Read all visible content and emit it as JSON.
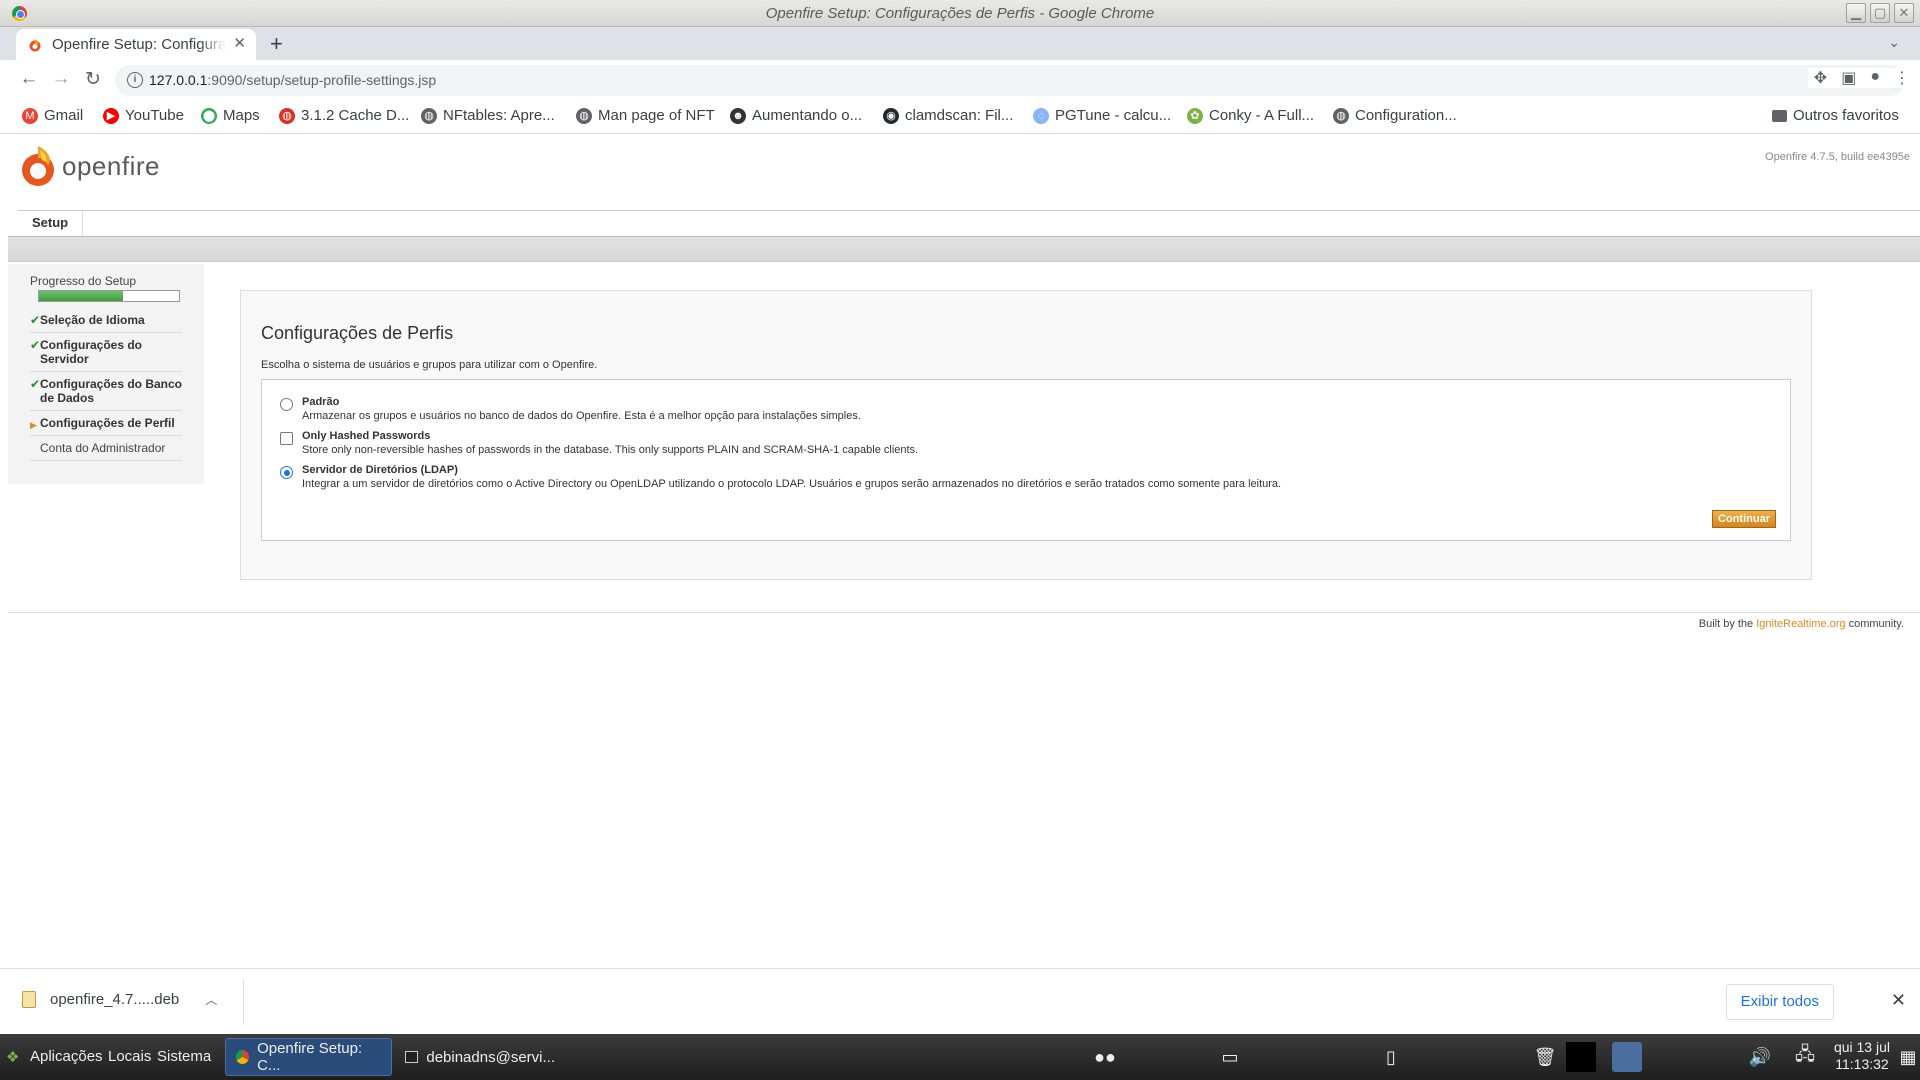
{
  "window": {
    "title": "Openfire Setup: Configurações de Perfis - Google Chrome",
    "buttons": [
      "▁",
      "▢",
      "✕"
    ]
  },
  "tabs": {
    "active_title": "Openfire Setup: Configurações de Perfis",
    "close": "✕",
    "new_tab": "+",
    "menu": "⌄"
  },
  "toolbar": {
    "back": "←",
    "forward": "→",
    "reload": "↻",
    "url_host": "127.0.0.1",
    "url_path": ":9090/setup/setup-profile-settings.jsp"
  },
  "bookmarks": [
    {
      "label": "Gmail",
      "icon": "gmail-icon",
      "color": "#ea4335"
    },
    {
      "label": "YouTube",
      "icon": "youtube-icon",
      "color": "#ff0000"
    },
    {
      "label": "Maps",
      "icon": "maps-icon",
      "color": "#34a853"
    },
    {
      "label": "3.1.2 Cache D...",
      "icon": "globe-icon",
      "color": "#d93025"
    },
    {
      "label": "NFtables: Apre...",
      "icon": "globe-icon",
      "color": "#5f6368"
    },
    {
      "label": "Man page of NFT",
      "icon": "globe-icon",
      "color": "#5f6368"
    },
    {
      "label": "Aumentando o...",
      "icon": "linux-icon",
      "color": "#333333"
    },
    {
      "label": "clamdscan: Fil...",
      "icon": "github-icon",
      "color": "#24292e"
    },
    {
      "label": "PGTune - calcu...",
      "icon": "pgtune-icon",
      "color": "#8ab4f8"
    },
    {
      "label": "Conky - A Full...",
      "icon": "conky-icon",
      "color": "#7cb342"
    },
    {
      "label": "Configuration...",
      "icon": "globe-icon",
      "color": "#5f6368"
    }
  ],
  "bookmarks_other": "Outros favoritos",
  "openfire": {
    "logo_text": "openfire",
    "version": "Openfire 4.7.5, build ee4395e",
    "nav_tab": "Setup",
    "sidebar": {
      "title": "Progresso do Setup",
      "progress": 0.6,
      "items": [
        {
          "label": "Seleção de Idioma",
          "state": "done"
        },
        {
          "label": "Configurações do Servidor",
          "state": "done"
        },
        {
          "label": "Configurações do Banco de Dados",
          "state": "done"
        },
        {
          "label": "Configurações de Perfil",
          "state": "current"
        },
        {
          "label": "Conta do Administrador",
          "state": "pending"
        }
      ]
    },
    "heading": "Configurações de Perfis",
    "intro": "Escolha o sistema de usuários e grupos para utilizar com o Openfire.",
    "options": [
      {
        "label": "Padrão",
        "desc": "Armazenar os grupos e usuários no banco de dados do Openfire. Esta é a melhor opção para instalações simples.",
        "type": "radio",
        "checked": false
      },
      {
        "label": "Only Hashed Passwords",
        "desc": "Store only non-reversible hashes of passwords in the database. This only supports PLAIN and SCRAM-SHA-1 capable clients.",
        "type": "checkbox",
        "checked": false
      },
      {
        "label": "Servidor de Diretórios (LDAP)",
        "desc": "Integrar a um servidor de diretórios como o Active Directory ou OpenLDAP utilizando o protocolo LDAP. Usuários e grupos serão armazenados no diretórios e serão tratados como somente para leitura.",
        "type": "radio",
        "checked": true
      }
    ],
    "continue_label": "Continuar",
    "footer_prefix": "Built by the ",
    "footer_link": "IgniteRealtime.org",
    "footer_suffix": " community."
  },
  "downloads": {
    "file": "openfire_4.7.....deb",
    "show_all": "Exibir todos",
    "close": "✕"
  },
  "taskbar": {
    "menus": [
      "Aplicações",
      "Locais",
      "Sistema"
    ],
    "tasks": [
      {
        "label": "Openfire Setup: C...",
        "active": true
      },
      {
        "label": "debinadns@servi...",
        "active": false
      }
    ],
    "date": "qui 13 jul",
    "time": "11:13:32"
  },
  "colors": {
    "accent_orange": "#e08a1e",
    "progress_green": "#3f9f3f",
    "link_blue": "#1a73e8"
  }
}
